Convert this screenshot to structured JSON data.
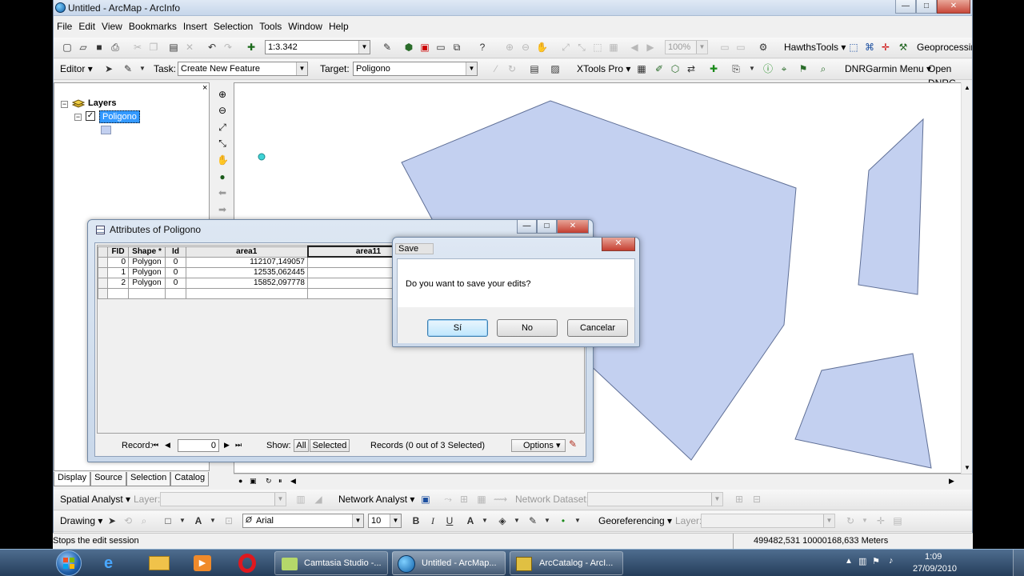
{
  "window": {
    "title": "Untitled - ArcMap - ArcInfo",
    "controls": {
      "minimize": "—",
      "maximize": "□",
      "close": "✕"
    }
  },
  "menu": [
    "File",
    "Edit",
    "View",
    "Bookmarks",
    "Insert",
    "Selection",
    "Tools",
    "Window",
    "Help"
  ],
  "standard_toolbar": {
    "scale": "1:3.342",
    "zoom": "100%",
    "hawths_tools": "HawthsTools",
    "geoprocessing": "Geoprocessing"
  },
  "editor_toolbar": {
    "editor_label": "Editor",
    "task_label": "Task:",
    "task_value": "Create New Feature",
    "target_label": "Target:",
    "target_value": "Poligono",
    "xtools": "XTools Pro",
    "dnrgarmin": "DNRGarmin Menu",
    "open_dnrg": "Open DNRG"
  },
  "toc": {
    "root": "Layers",
    "layer": "Poligono",
    "close": "×",
    "tabs": [
      "Display",
      "Source",
      "Selection",
      "Catalog"
    ]
  },
  "attributes": {
    "title": "Attributes of Poligono",
    "columns": [
      "FID",
      "Shape *",
      "Id",
      "area1",
      "area11"
    ],
    "rows": [
      {
        "fid": "0",
        "shape": "Polygon",
        "id": "0",
        "area1": "112107,149057"
      },
      {
        "fid": "1",
        "shape": "Polygon",
        "id": "0",
        "area1": "12535,062445"
      },
      {
        "fid": "2",
        "shape": "Polygon",
        "id": "0",
        "area1": "15852,097778"
      }
    ],
    "record_label": "Record:",
    "record_value": "0",
    "show_label": "Show:",
    "all_btn": "All",
    "selected_btn": "Selected",
    "records_text": "Records (0 out of 3 Selected)",
    "options_btn": "Options"
  },
  "save_dialog": {
    "title": "Save",
    "message": "Do you want to save your edits?",
    "yes": "Sí",
    "no": "No",
    "cancel": "Cancelar",
    "close": "✕"
  },
  "spatial_toolbar": {
    "spatial_analyst": "Spatial Analyst",
    "layer_label": "Layer:",
    "network_analyst": "Network Analyst",
    "network_dataset_label": "Network Dataset:"
  },
  "drawing_toolbar": {
    "drawing": "Drawing",
    "font": "Arial",
    "font_size": "10",
    "bold": "B",
    "italic": "I",
    "underline": "U",
    "georeferencing": "Georeferencing",
    "layer_label": "Layer:"
  },
  "status": {
    "message": "Stops the edit session",
    "coordinates": "499482,531  10000168,633 Meters"
  },
  "taskbar": {
    "items": [
      "Camtasia Studio -...",
      "Untitled - ArcMap...",
      "ArcCatalog - ArcI..."
    ],
    "time": "1:09",
    "date": "27/09/2010"
  },
  "colors": {
    "polygon_fill": "#c3d0f0",
    "polygon_stroke": "#5f6f96",
    "point": "#3fd3d6"
  }
}
